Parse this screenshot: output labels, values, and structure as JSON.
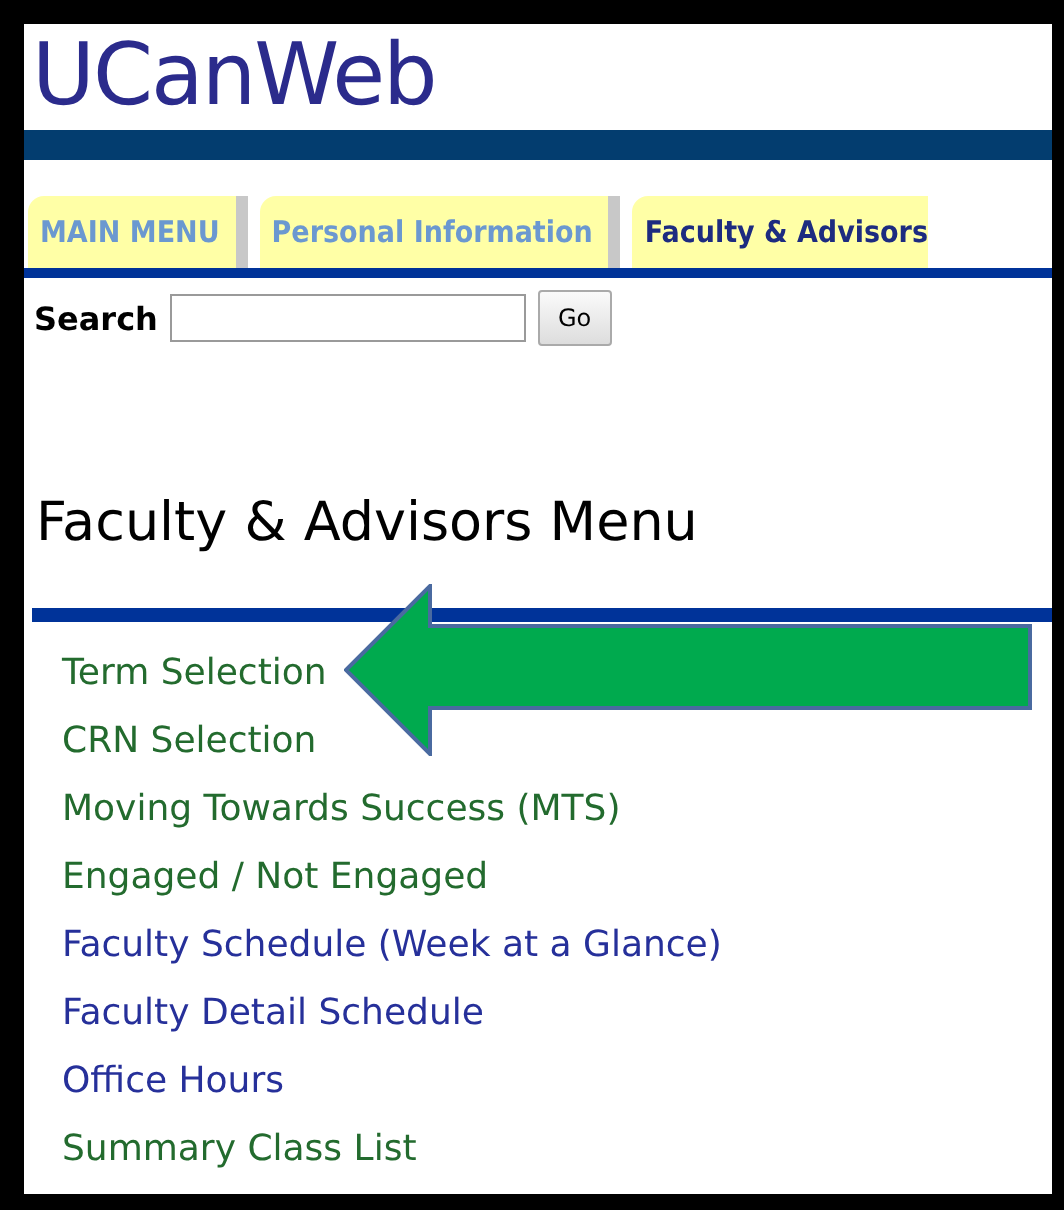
{
  "header": {
    "title": "UCanWeb"
  },
  "tabs": [
    {
      "label": "MAIN MENU",
      "selected": false
    },
    {
      "label": "Personal Information",
      "selected": false
    },
    {
      "label": "Faculty & Advisors",
      "selected": true
    }
  ],
  "search": {
    "label": "Search",
    "button": "Go"
  },
  "page_title": "Faculty & Advisors Menu",
  "menu_links": [
    {
      "label": "Term Selection",
      "visited": true
    },
    {
      "label": "CRN Selection",
      "visited": true
    },
    {
      "label": "Moving Towards Success (MTS)",
      "visited": true
    },
    {
      "label": "Engaged / Not Engaged",
      "visited": true
    },
    {
      "label": "Faculty Schedule (Week at a Glance)",
      "visited": false
    },
    {
      "label": "Faculty Detail Schedule",
      "visited": false
    },
    {
      "label": "Office Hours",
      "visited": false
    },
    {
      "label": "Summary Class List",
      "visited": true
    }
  ]
}
